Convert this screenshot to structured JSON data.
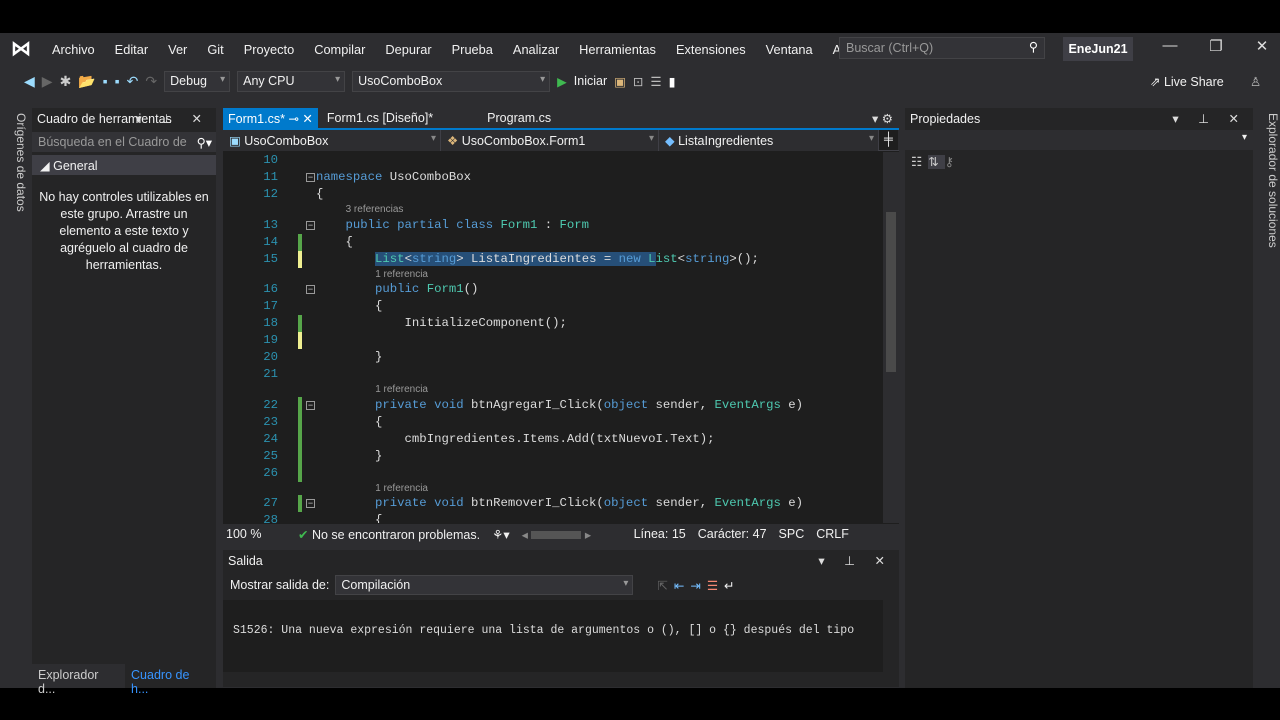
{
  "menu": [
    "Archivo",
    "Editar",
    "Ver",
    "Git",
    "Proyecto",
    "Compilar",
    "Depurar",
    "Prueba",
    "Analizar",
    "Herramientas",
    "Extensiones",
    "Ventana",
    "Ayuda"
  ],
  "search_placeholder": "Buscar (Ctrl+Q)",
  "solution_name": "EneJun21",
  "toolbar": {
    "config": "Debug",
    "platform": "Any CPU",
    "startup": "UsoComboBox",
    "start": "Iniciar",
    "live_share": "Live Share"
  },
  "left_strip": "Orígenes de datos",
  "right_strip": "Explorador de soluciones",
  "toolbox": {
    "title": "Cuadro de herramientas",
    "search": "Búsqueda en el Cuadro de",
    "group": "General",
    "empty": "No hay controles utilizables en este grupo. Arrastre un elemento a este texto y agréguelo al cuadro de herramientas.",
    "tabs": [
      "Explorador d...",
      "Cuadro de h..."
    ]
  },
  "editor": {
    "tabs": [
      "Form1.cs*",
      "Form1.cs [Diseño]*",
      "Program.cs"
    ],
    "nav": [
      "UsoComboBox",
      "UsoComboBox.Form1",
      "ListaIngredientes"
    ],
    "lines": [
      {
        "n": "10",
        "seg": []
      },
      {
        "n": "11",
        "fold": true,
        "seg": [
          [
            "namespace ",
            "k"
          ],
          [
            "UsoComboBox",
            "p"
          ]
        ]
      },
      {
        "n": "12",
        "seg": [
          [
            "{",
            "p"
          ]
        ]
      },
      {
        "ref": "3 referencias",
        "indent": 4
      },
      {
        "n": "13",
        "fold": true,
        "seg": [
          [
            "    public partial class ",
            "k"
          ],
          [
            "Form1",
            "t"
          ],
          [
            " : ",
            "p"
          ],
          [
            "Form",
            "t"
          ]
        ]
      },
      {
        "n": "14",
        "mark": "saved",
        "seg": [
          [
            "    {",
            "p"
          ]
        ]
      },
      {
        "n": "15",
        "mark": "unsaved",
        "seg": [
          [
            "        ",
            "p"
          ],
          [
            "List",
            "t sel"
          ],
          [
            "<",
            "p sel"
          ],
          [
            "string",
            "k sel"
          ],
          [
            "> ListaIngredientes = ",
            "p sel"
          ],
          [
            "new ",
            "k sel"
          ],
          [
            "L",
            "t sel"
          ],
          [
            "ist",
            "t"
          ],
          [
            "<",
            "p"
          ],
          [
            "string",
            "k"
          ],
          [
            ">();",
            "p"
          ]
        ]
      },
      {
        "ref": "1 referencia",
        "indent": 8
      },
      {
        "n": "16",
        "fold": true,
        "seg": [
          [
            "        public ",
            "k"
          ],
          [
            "Form1",
            "t"
          ],
          [
            "()",
            "p"
          ]
        ]
      },
      {
        "n": "17",
        "seg": [
          [
            "        {",
            "p"
          ]
        ]
      },
      {
        "n": "18",
        "mark": "saved",
        "seg": [
          [
            "            InitializeComponent();",
            "p"
          ]
        ]
      },
      {
        "n": "19",
        "mark": "unsaved",
        "seg": []
      },
      {
        "n": "20",
        "seg": [
          [
            "        }",
            "p"
          ]
        ]
      },
      {
        "n": "21",
        "seg": []
      },
      {
        "ref": "1 referencia",
        "indent": 8
      },
      {
        "n": "22",
        "mark": "saved",
        "fold": true,
        "seg": [
          [
            "        private void ",
            "k"
          ],
          [
            "btnAgregarI_Click(",
            "p"
          ],
          [
            "object ",
            "k"
          ],
          [
            "sender, ",
            "p"
          ],
          [
            "EventArgs ",
            "t"
          ],
          [
            "e)",
            "p"
          ]
        ]
      },
      {
        "n": "23",
        "mark": "saved",
        "seg": [
          [
            "        {",
            "p"
          ]
        ]
      },
      {
        "n": "24",
        "mark": "saved",
        "seg": [
          [
            "            cmbIngredientes.Items.Add(txtNuevoI.Text);",
            "p"
          ]
        ]
      },
      {
        "n": "25",
        "mark": "saved",
        "seg": [
          [
            "        }",
            "p"
          ]
        ]
      },
      {
        "n": "26",
        "mark": "saved",
        "seg": []
      },
      {
        "ref": "1 referencia",
        "indent": 8
      },
      {
        "n": "27",
        "mark": "saved",
        "fold": true,
        "seg": [
          [
            "        private void ",
            "k"
          ],
          [
            "btnRemoverI_Click(",
            "p"
          ],
          [
            "object ",
            "k"
          ],
          [
            "sender, ",
            "p"
          ],
          [
            "EventArgs ",
            "t"
          ],
          [
            "e)",
            "p"
          ]
        ]
      },
      {
        "n": "28",
        "seg": [
          [
            "        {",
            "p"
          ]
        ]
      }
    ],
    "status": {
      "zoom": "100 %",
      "problems": "No se encontraron problemas.",
      "line": "Línea: 15",
      "char": "Carácter: 47",
      "spc": "SPC",
      "eol": "CRLF"
    }
  },
  "output": {
    "title": "Salida",
    "show_label": "Mostrar salida de:",
    "source": "Compilación",
    "message": "S1526: Una nueva expresión requiere una lista de argumentos o (), [] o {} después del tipo"
  },
  "properties": {
    "title": "Propiedades"
  }
}
